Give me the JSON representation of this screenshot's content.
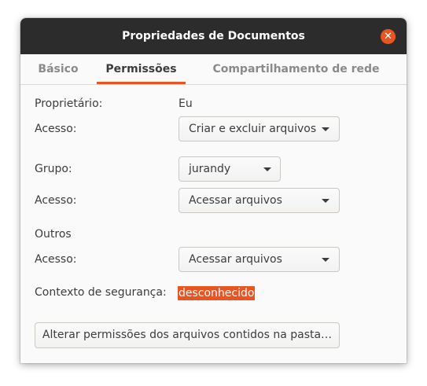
{
  "window": {
    "title": "Propriedades de Documentos"
  },
  "tabs": [
    {
      "label": "Básico",
      "active": false
    },
    {
      "label": "Permissões",
      "active": true
    },
    {
      "label": "Compartilhamento de rede local",
      "active": false
    }
  ],
  "owner": {
    "label": "Proprietário:",
    "value": "Eu",
    "access_label": "Acesso:",
    "access_value": "Criar e excluir arquivos"
  },
  "group": {
    "label": "Grupo:",
    "value": "jurandy",
    "access_label": "Acesso:",
    "access_value": "Acessar arquivos"
  },
  "others": {
    "label": "Outros",
    "access_label": "Acesso:",
    "access_value": "Acessar arquivos"
  },
  "security": {
    "label": "Contexto de segurança:",
    "value": "desconhecido"
  },
  "change_button": {
    "label": "Alterar permissões dos arquivos contidos na pasta…"
  },
  "colors": {
    "accent": "#e95420",
    "titlebar": "#2c2c2c"
  },
  "icons": {
    "close": "close-icon",
    "dropdown": "chevron-down-icon"
  }
}
